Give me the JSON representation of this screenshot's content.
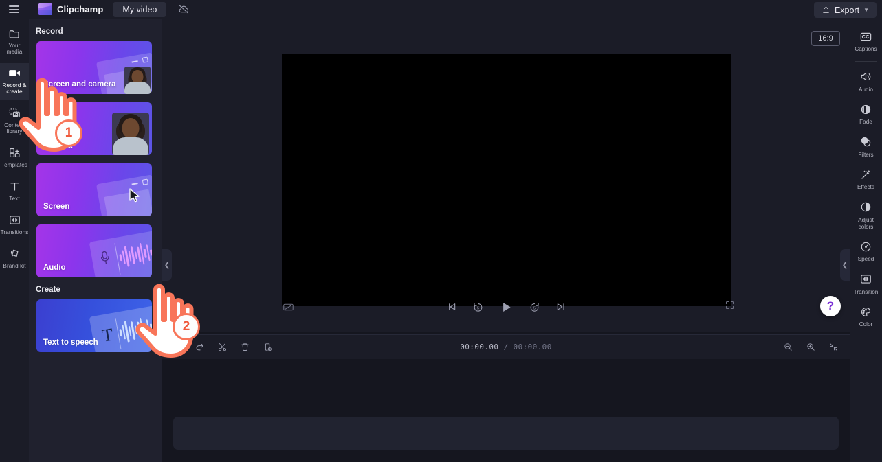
{
  "app": {
    "brand": "Clipchamp",
    "project_name": "My video",
    "export_label": "Export",
    "ratio_badge": "16:9",
    "help_label": "?"
  },
  "left_rail": {
    "items": [
      {
        "label": "Your media",
        "icon": "folder-icon",
        "active": false
      },
      {
        "label": "Record &\ncreate",
        "icon": "video-camera-icon",
        "active": true
      },
      {
        "label": "Content\nlibrary",
        "icon": "content-library-icon",
        "active": false
      },
      {
        "label": "Templates",
        "icon": "templates-icon",
        "active": false
      },
      {
        "label": "Text",
        "icon": "text-icon",
        "active": false
      },
      {
        "label": "Transitions",
        "icon": "transitions-icon",
        "active": false
      },
      {
        "label": "Brand kit",
        "icon": "brand-kit-icon",
        "active": false
      }
    ]
  },
  "panel": {
    "section_record": "Record",
    "section_create": "Create",
    "record_cards": [
      {
        "label": "Screen and camera",
        "art": "window-with-face"
      },
      {
        "label": "Camera",
        "art": "face"
      },
      {
        "label": "Screen",
        "art": "window-with-cursor"
      },
      {
        "label": "Audio",
        "art": "mic-wave"
      }
    ],
    "create_cards": [
      {
        "label": "Text to speech",
        "art": "text-wave"
      }
    ]
  },
  "stage": {
    "preview_placeholder": "",
    "playback": {
      "captions_toggle": "captions-off-icon",
      "skip_back": "skip-previous-icon",
      "rewind": "rewind-5-icon",
      "play": "play-icon",
      "forward": "forward-5-icon",
      "skip_forward": "skip-next-icon",
      "fullscreen": "fullscreen-icon"
    }
  },
  "timeline": {
    "toolbar_left": [
      {
        "name": "undo-icon",
        "label": "Undo"
      },
      {
        "name": "redo-icon",
        "label": "Redo"
      },
      {
        "name": "split-scissors-icon",
        "label": "Split"
      },
      {
        "name": "delete-trash-icon",
        "label": "Delete"
      },
      {
        "name": "duplicate-icon",
        "label": "Duplicate"
      }
    ],
    "current_time": "00:00.00",
    "separator": "/",
    "total_time": "00:00.00",
    "toolbar_right": [
      {
        "name": "zoom-out-icon",
        "label": "Zoom out"
      },
      {
        "name": "zoom-in-icon",
        "label": "Zoom in"
      },
      {
        "name": "fit-to-screen-icon",
        "label": "Fit to screen"
      }
    ]
  },
  "right_rail": {
    "items": [
      {
        "label": "Captions",
        "icon": "captions-cc-icon",
        "sep_after": true
      },
      {
        "label": "Audio",
        "icon": "speaker-icon",
        "sep_after": false
      },
      {
        "label": "Fade",
        "icon": "fade-icon",
        "sep_after": false
      },
      {
        "label": "Filters",
        "icon": "filters-icon",
        "sep_after": false
      },
      {
        "label": "Effects",
        "icon": "effects-wand-icon",
        "sep_after": false
      },
      {
        "label": "Adjust\ncolors",
        "icon": "adjust-colors-icon",
        "sep_after": false
      },
      {
        "label": "Speed",
        "icon": "speed-gauge-icon",
        "sep_after": false
      },
      {
        "label": "Transition",
        "icon": "transition-icon",
        "sep_after": false
      },
      {
        "label": "Color",
        "icon": "color-palette-icon",
        "sep_after": false
      }
    ]
  },
  "annotations": {
    "step_one": "1",
    "step_two": "2"
  },
  "colors": {
    "accent_purple": "#8c35ec",
    "accent_blue": "#3d63e8",
    "annotation_coral": "#f87559",
    "panel_bg": "#20212e",
    "rail_bg": "#1b1c27",
    "app_bg": "#15161f"
  }
}
